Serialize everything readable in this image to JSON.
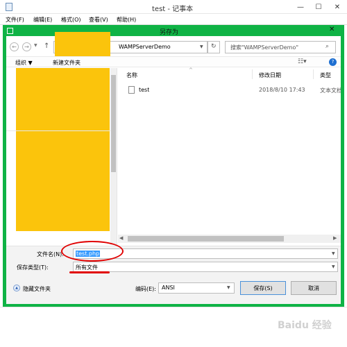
{
  "notepad": {
    "title": "test - 记事本",
    "menu": [
      "文件(F)",
      "编辑(E)",
      "格式(O)",
      "查看(V)",
      "帮助(H)"
    ]
  },
  "dialog": {
    "title": "另存为",
    "address": {
      "current_folder": "WAMPServerDemo"
    },
    "search": {
      "placeholder": "搜索\"WAMPServerDemo\""
    },
    "toolbar": {
      "organize": "组织 ▼",
      "new_folder": "新建文件夹"
    },
    "columns": {
      "name": "名称",
      "modified": "修改日期",
      "type": "类型"
    },
    "files": [
      {
        "name": "test",
        "modified": "2018/8/10 17:43",
        "type": "文本文档"
      }
    ],
    "filename": {
      "label": "文件名(N):",
      "value": "test.php"
    },
    "filetype": {
      "label": "保存类型(T):",
      "value": "所有文件"
    },
    "hide_folders": "隐藏文件夹",
    "encoding": {
      "label": "编码(E):",
      "value": "ANSI"
    },
    "save_button": "保存(S)",
    "cancel_button": "取消"
  },
  "colors": {
    "dialog_frame": "#0fb345",
    "annotation": "#e00000",
    "redaction": "#fbc40c",
    "selection": "#3399ff"
  },
  "watermark": "Baidu 经验"
}
